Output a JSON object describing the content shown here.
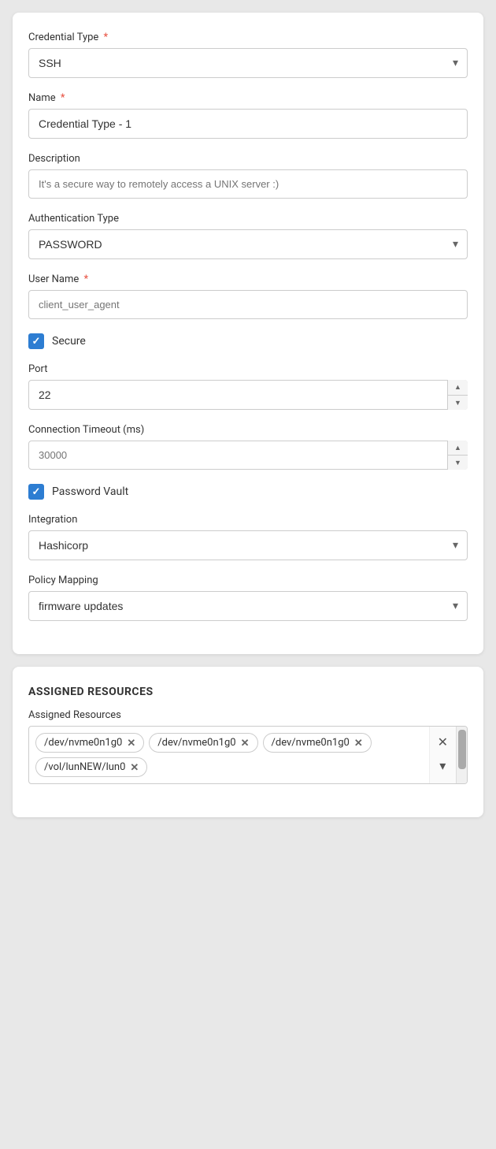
{
  "form": {
    "credential_type_label": "Credential Type",
    "credential_type_value": "SSH",
    "name_label": "Name",
    "name_value": "Credential Type - 1",
    "description_label": "Description",
    "description_placeholder": "It's a secure way to remotely access a UNIX server :)",
    "auth_type_label": "Authentication Type",
    "auth_type_value": "PASSWORD",
    "username_label": "User Name",
    "username_placeholder": "client_user_agent",
    "secure_label": "Secure",
    "secure_checked": true,
    "port_label": "Port",
    "port_value": "22",
    "timeout_label": "Connection Timeout (ms)",
    "timeout_placeholder": "30000",
    "password_vault_label": "Password Vault",
    "password_vault_checked": true,
    "integration_label": "Integration",
    "integration_value": "Hashicorp",
    "policy_mapping_label": "Policy Mapping",
    "policy_mapping_value": "firmware updates"
  },
  "assigned_resources": {
    "section_title": "ASSIGNED RESOURCES",
    "label": "Assigned Resources",
    "tags": [
      "/dev/nvme0n1g0",
      "/dev/nvme0n1g0",
      "/dev/nvme0n1g0",
      "/vol/lunNEW/lun0"
    ],
    "chevron_down": "▾",
    "close_x": "✕"
  },
  "icons": {
    "chevron_down": "▾",
    "chevron_up": "▴",
    "checkmark": "✓",
    "close": "✕",
    "up_arrow": "▲",
    "down_arrow": "▼"
  }
}
